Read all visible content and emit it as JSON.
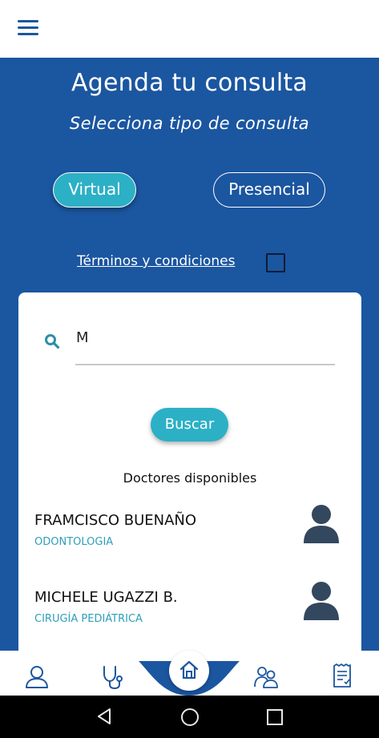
{
  "header": {
    "title": "Agenda tu consulta",
    "subtitle": "Selecciona tipo de consulta"
  },
  "consult_types": {
    "virtual_label": "Virtual",
    "presencial_label": "Presencial",
    "selected": "Virtual"
  },
  "terms": {
    "label": "Términos y condiciones",
    "checked": false
  },
  "search": {
    "value": "M",
    "button_label": "Buscar"
  },
  "doctors": {
    "heading": "Doctores disponibles",
    "items": [
      {
        "name": "FRAMCISCO BUENAÑO",
        "specialty": "ODONTOLOGIA"
      },
      {
        "name": "MICHELE UGAZZI B.",
        "specialty": "CIRUGÍA PEDIÁTRICA"
      }
    ]
  },
  "colors": {
    "primary_blue": "#1b56a0",
    "accent_teal": "#2cb0c6",
    "specialty_text": "#2f9fb8",
    "avatar": "#33475e"
  },
  "bottom_nav": {
    "icons": [
      "user-icon",
      "stethoscope-icon",
      "home-icon",
      "doctors-icon",
      "document-icon"
    ],
    "active": "home-icon"
  },
  "system_nav": {
    "icons": [
      "back-icon",
      "home-circle-icon",
      "recents-icon"
    ]
  }
}
